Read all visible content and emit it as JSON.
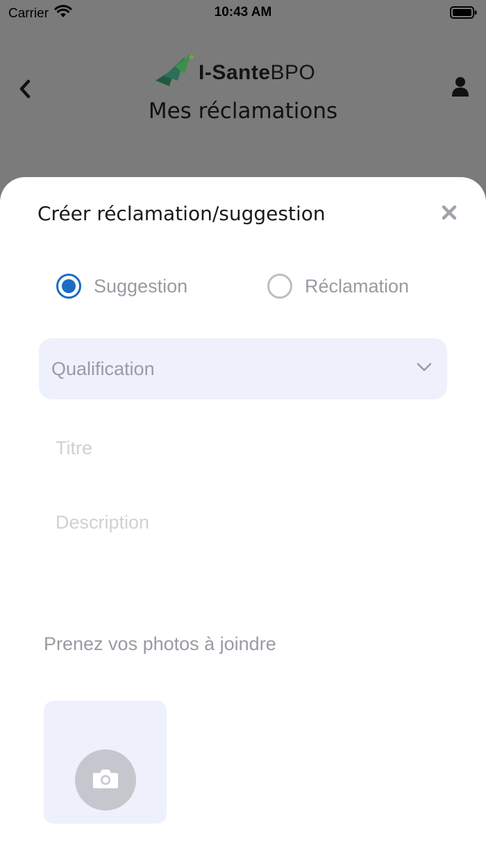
{
  "status_bar": {
    "carrier": "Carrier",
    "time": "10:43 AM"
  },
  "header": {
    "logo_bold": "I-Sante",
    "logo_light": "BPO",
    "title": "Mes réclamations"
  },
  "sheet": {
    "title": "Créer réclamation/suggestion",
    "radio_options": [
      {
        "label": "Suggestion",
        "selected": true
      },
      {
        "label": "Réclamation",
        "selected": false
      }
    ],
    "qualification_placeholder": "Qualification",
    "titre_placeholder": "Titre",
    "description_placeholder": "Description",
    "photos_label": "Prenez vos photos à joindre"
  },
  "colors": {
    "accent": "#1a6cc4",
    "field_bg": "#eef1fc",
    "overlay": "#7b7b7b"
  },
  "icons": [
    "wifi-icon",
    "battery-icon",
    "back-chevron-icon",
    "user-icon",
    "close-icon",
    "chevron-down-icon",
    "camera-icon",
    "logo-icon"
  ]
}
